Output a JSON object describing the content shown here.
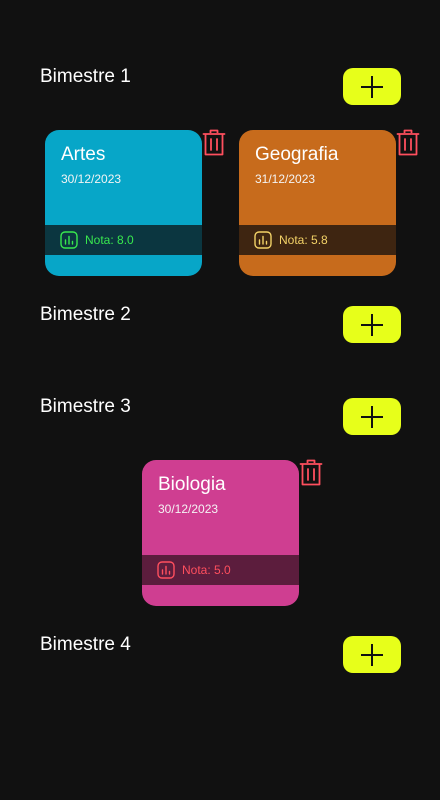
{
  "colors": {
    "background": "#111111",
    "accent_add": "#e7ff1a",
    "trash": "#ff4f5e"
  },
  "bimesters": [
    {
      "title": "Bimestre 1",
      "cards": [
        {
          "subject": "Artes",
          "date": "30/12/2023",
          "grade_label": "Nota: 8.0",
          "color": "#07a6c8",
          "footer_color": "#0b3640",
          "grade_color": "#38e84e"
        },
        {
          "subject": "Geografia",
          "date": "31/12/2023",
          "grade_label": "Nota: 5.8",
          "color": "#c76b1c",
          "footer_color": "#3e2511",
          "grade_color": "#f3d267"
        }
      ]
    },
    {
      "title": "Bimestre 2",
      "cards": []
    },
    {
      "title": "Bimestre 3",
      "cards": [
        {
          "subject": "Biologia",
          "date": "30/12/2023",
          "grade_label": "Nota: 5.0",
          "color": "#cf3e91",
          "footer_color": "#5c1d3d",
          "grade_color": "#ff4f5e"
        }
      ]
    },
    {
      "title": "Bimestre 4",
      "cards": []
    }
  ]
}
